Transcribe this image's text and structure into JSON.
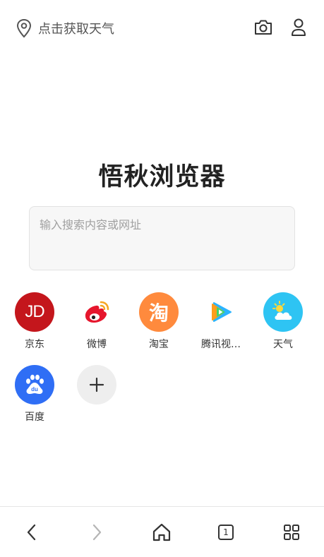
{
  "header": {
    "location_text": "点击获取天气",
    "location_icon": "location-pin-icon",
    "camera_icon": "camera-icon",
    "user_icon": "user-icon"
  },
  "brand": {
    "title": "悟秋浏览器"
  },
  "search": {
    "placeholder": "输入搜索内容或网址",
    "value": ""
  },
  "shortcuts": [
    {
      "label": "京东",
      "icon": "jd-icon",
      "color": "#c4161c"
    },
    {
      "label": "微博",
      "icon": "weibo-icon",
      "color": "#e6162d"
    },
    {
      "label": "淘宝",
      "icon": "taobao-icon",
      "color": "#ff8a3d"
    },
    {
      "label": "腾讯视…",
      "icon": "tencent-video-icon",
      "color": "#2bb4ff"
    },
    {
      "label": "天气",
      "icon": "weather-icon",
      "color": "#2ec4f3"
    },
    {
      "label": "百度",
      "icon": "baidu-icon",
      "color": "#2f6ef5"
    },
    {
      "label": "",
      "icon": "add-icon",
      "color": "#eeeeee"
    }
  ],
  "shortcut_text": {
    "jd": "JD",
    "taobao": "淘",
    "baidu": "du"
  },
  "bottom_nav": {
    "back_icon": "back-icon",
    "forward_icon": "forward-icon",
    "home_icon": "home-icon",
    "tab_count": "1",
    "menu_icon": "grid-menu-icon"
  }
}
